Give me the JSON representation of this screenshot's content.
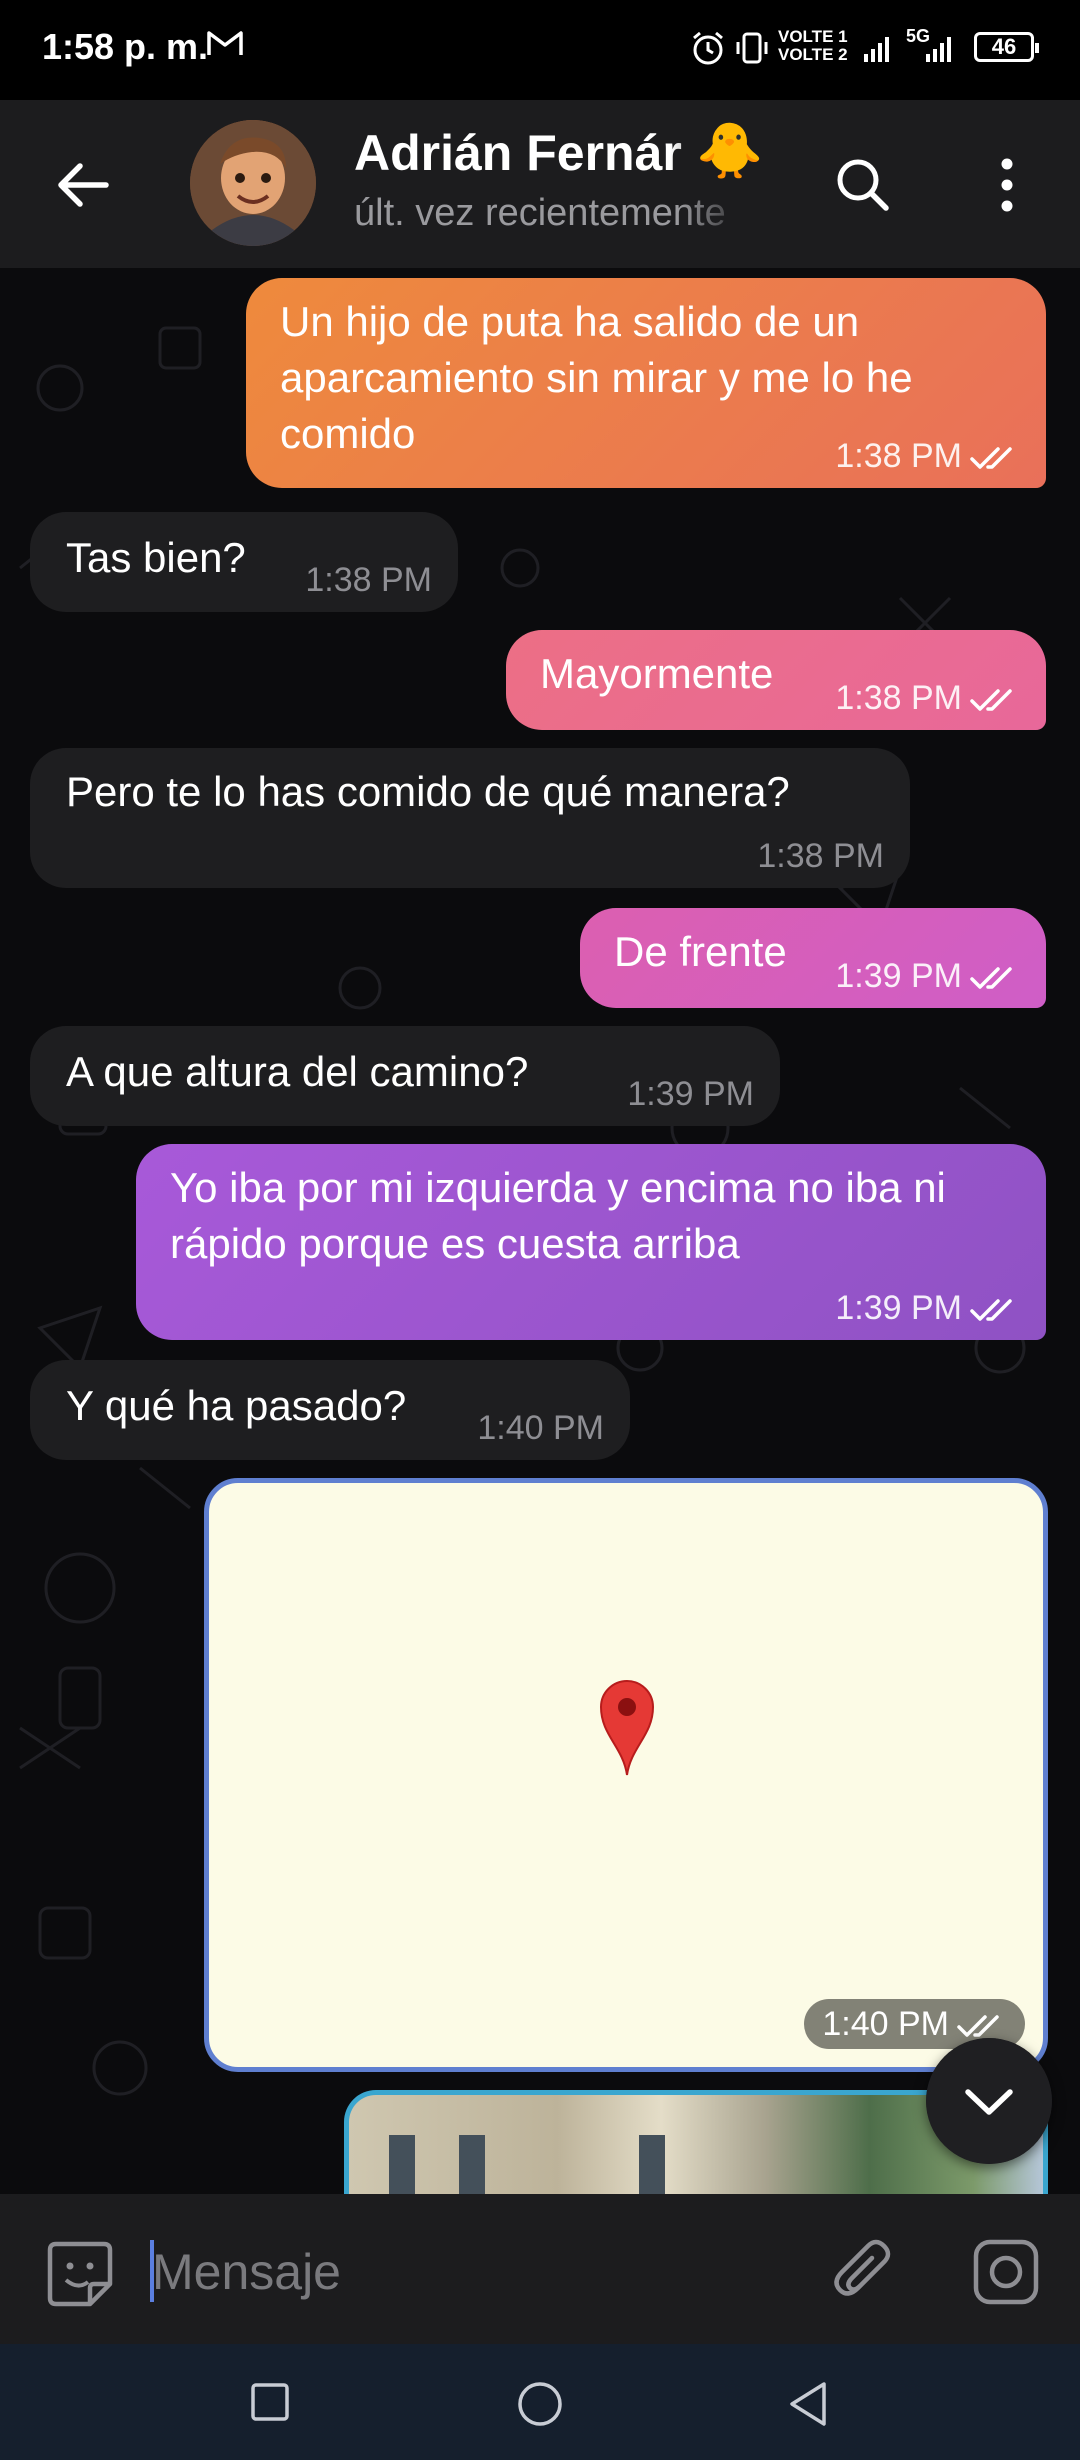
{
  "status_bar": {
    "time": "1:58 p. m.",
    "volte1": "VOLTE 1",
    "volte2": "VOLTE 2",
    "network": "5G",
    "battery": "46"
  },
  "header": {
    "contact_name": "Adrián Fernár",
    "emoji": "🐥",
    "status": "últ. vez recientemente"
  },
  "messages": [
    {
      "direction": "out",
      "text": "Un hijo de puta ha salido de un aparcamiento sin mirar y me lo he comido",
      "time": "1:38 PM",
      "read": true
    },
    {
      "direction": "in",
      "text": "Tas bien?",
      "time": "1:38 PM"
    },
    {
      "direction": "out",
      "text": "Mayormente",
      "time": "1:38 PM",
      "read": true
    },
    {
      "direction": "in",
      "text": "Pero te lo has comido de qué manera?",
      "time": "1:38 PM"
    },
    {
      "direction": "out",
      "text": "De frente",
      "time": "1:39 PM",
      "read": true
    },
    {
      "direction": "in",
      "text": "A que altura del camino?",
      "time": "1:39 PM"
    },
    {
      "direction": "out",
      "text": "Yo iba por mi izquierda y encima no iba ni rápido porque es cuesta arriba",
      "time": "1:39 PM",
      "read": true
    },
    {
      "direction": "in",
      "text": "Y qué ha pasado?",
      "time": "1:40 PM"
    },
    {
      "direction": "out",
      "type": "location",
      "time": "1:40 PM",
      "read": true
    }
  ],
  "input": {
    "placeholder": "Mensaje"
  },
  "colors": {
    "out_orange": "#ee8a3c",
    "out_pink": "#ec6f85",
    "out_magenta": "#dc5fb0",
    "out_purple": "#a859d9",
    "incoming": "#1e1e20",
    "map_bg": "#fcfbe6",
    "pin": "#e53935"
  },
  "icons": {
    "back": "arrow-left-icon",
    "search": "search-icon",
    "menu": "more-vertical-icon",
    "emoji": "sticker-icon",
    "attach": "paperclip-icon",
    "camera": "instagram-camera-icon",
    "scroll": "chevron-down-icon"
  }
}
